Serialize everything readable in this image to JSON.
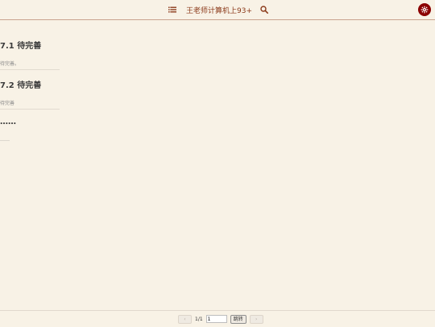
{
  "header": {
    "title": "王老师计算机上93+",
    "toc_icon": "list-icon",
    "search_icon": "search-icon",
    "settings_icon": "gear-icon",
    "accent_color": "#8b3a1a"
  },
  "sections": [
    {
      "heading": "7.1 待完善",
      "body": "待完善。"
    },
    {
      "heading": "7.2 待完善",
      "body": "待完善"
    },
    {
      "heading": "……",
      "body": "……"
    }
  ],
  "pagination": {
    "prev_label": "‹",
    "next_label": "›",
    "page_indicator": "1/1",
    "page_input_value": "1",
    "go_label": "跳转"
  }
}
